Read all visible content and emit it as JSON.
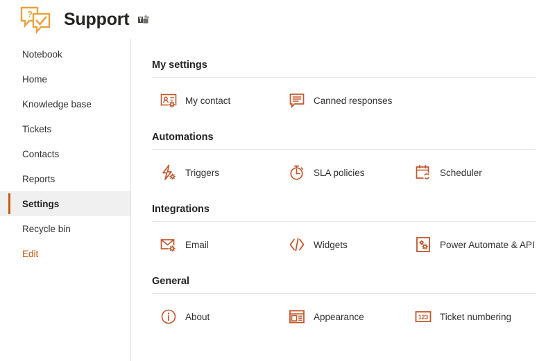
{
  "header": {
    "title": "Support",
    "logo_icon": "support-chat-check-icon",
    "teams_icon": "microsoft-teams-icon",
    "logo_color": "#E8A33D",
    "title_color": "#252423"
  },
  "theme": {
    "accent": "#C75B12",
    "icon_color": "#C0562A",
    "selected_bg": "#F0F0F0",
    "rule_color": "#E6E4E2",
    "text_color": "#323130"
  },
  "sidebar": {
    "items": [
      {
        "label": "Notebook",
        "name": "sidebar-item-notebook",
        "selected": false
      },
      {
        "label": "Home",
        "name": "sidebar-item-home",
        "selected": false
      },
      {
        "label": "Knowledge base",
        "name": "sidebar-item-knowledge-base",
        "selected": false
      },
      {
        "label": "Tickets",
        "name": "sidebar-item-tickets",
        "selected": false
      },
      {
        "label": "Contacts",
        "name": "sidebar-item-contacts",
        "selected": false
      },
      {
        "label": "Reports",
        "name": "sidebar-item-reports",
        "selected": false
      },
      {
        "label": "Settings",
        "name": "sidebar-item-settings",
        "selected": true
      },
      {
        "label": "Recycle bin",
        "name": "sidebar-item-recycle-bin",
        "selected": false
      },
      {
        "label": "Edit",
        "name": "sidebar-item-edit",
        "selected": false
      }
    ]
  },
  "main": {
    "sections": [
      {
        "title": "My settings",
        "items": [
          {
            "label": "My contact",
            "icon": "contact-card-gear-icon"
          },
          {
            "label": "Canned responses",
            "icon": "speech-bubble-lines-icon"
          }
        ]
      },
      {
        "title": "Automations",
        "items": [
          {
            "label": "Triggers",
            "icon": "lightning-bolt-gear-icon"
          },
          {
            "label": "SLA policies",
            "icon": "stopwatch-icon"
          },
          {
            "label": "Scheduler",
            "icon": "calendar-refresh-icon"
          }
        ]
      },
      {
        "title": "Integrations",
        "items": [
          {
            "label": "Email",
            "icon": "envelope-gear-icon"
          },
          {
            "label": "Widgets",
            "icon": "code-brackets-icon"
          },
          {
            "label": "Power Automate & API",
            "icon": "gears-box-icon"
          }
        ]
      },
      {
        "title": "General",
        "items": [
          {
            "label": "About",
            "icon": "info-circle-icon"
          },
          {
            "label": "Appearance",
            "icon": "layout-panel-icon"
          },
          {
            "label": "Ticket numbering",
            "icon": "numbers-box-icon"
          }
        ]
      }
    ]
  }
}
